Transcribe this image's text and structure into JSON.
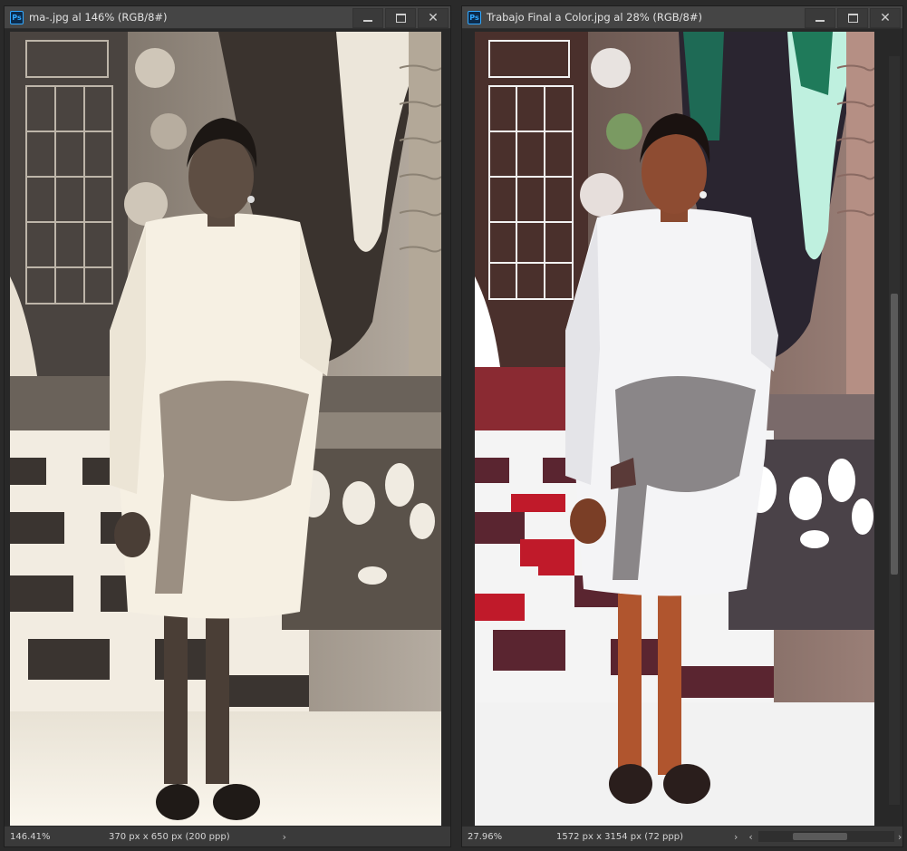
{
  "windows": [
    {
      "title": "ma-.jpg al 146% (RGB/8#)",
      "app_icon": "Ps",
      "zoom": "146.41%",
      "dimensions": "370 px x 650 px (200 ppp)",
      "status_arrow": "›",
      "controls": {
        "minimize": "minimize-icon",
        "maximize": "maximize-icon",
        "close": "✕"
      }
    },
    {
      "title": "Trabajo Final a Color.jpg al 28% (RGB/8#)",
      "app_icon": "Ps",
      "zoom": "27.96%",
      "dimensions": "1572 px x 3154 px (72 ppp)",
      "status_arrow": "›",
      "scroll_left_arrow": "‹",
      "scroll_right_arrow": "›",
      "controls": {
        "minimize": "minimize-icon",
        "maximize": "maximize-icon",
        "close": "✕"
      }
    }
  ],
  "colors": {
    "app_bg": "#2a2a2a",
    "titlebar": "#454545",
    "ps_blue": "#31a8ff",
    "sepia_paper": "#f5efe2",
    "accent_red": "#c01a2a"
  }
}
